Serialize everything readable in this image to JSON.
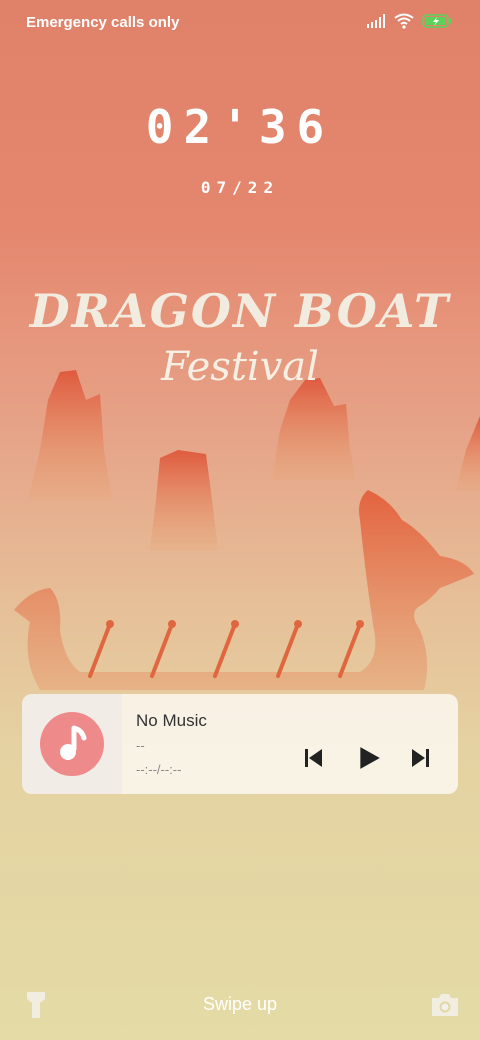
{
  "status_bar": {
    "carrier_text": "Emergency calls only",
    "icons": [
      "signal-icon",
      "wifi-icon",
      "battery-charging-icon"
    ],
    "battery_color": "#5bd35b"
  },
  "lockscreen": {
    "time": "02'36",
    "date": "07/22"
  },
  "wallpaper": {
    "title_main": "DRAGON BOAT",
    "title_sub": "Festival"
  },
  "music_widget": {
    "album_icon": "music-note-icon",
    "album_color": "#ef8a8a",
    "track_title": "No Music",
    "track_artist": "--",
    "track_time": "--:--/--:--",
    "controls": [
      "previous-icon",
      "play-icon",
      "next-icon"
    ]
  },
  "bottom_bar": {
    "flashlight_icon": "flashlight-icon",
    "hint": "Swipe up",
    "camera_icon": "camera-icon"
  }
}
